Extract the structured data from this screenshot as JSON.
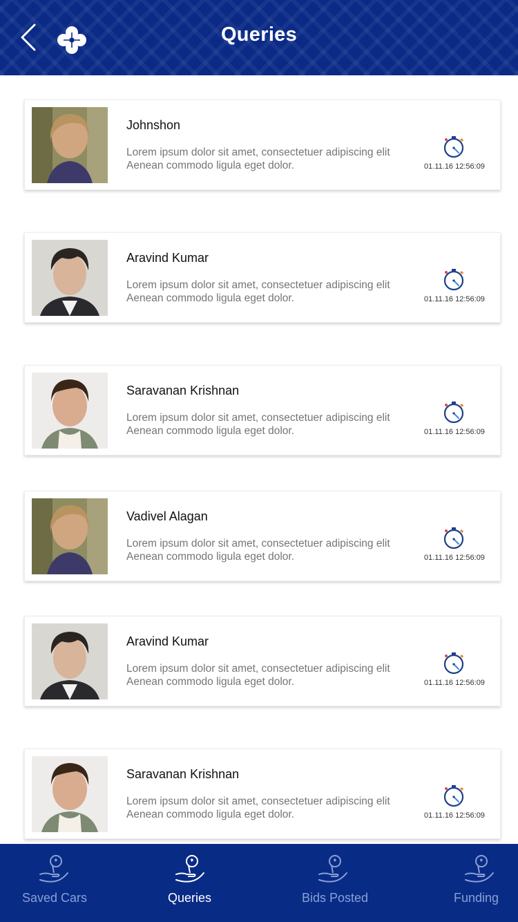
{
  "header": {
    "title": "Queries"
  },
  "queries": [
    {
      "name": "Johnshon",
      "message_line1": "Lorem ipsum dolor sit amet, consectetuer adipiscing elit",
      "message_line2": "Aenean commodo ligula eget dolor.",
      "time": "01.11.16 12:56:09"
    },
    {
      "name": "Aravind Kumar",
      "message_line1": "Lorem ipsum dolor sit amet, consectetuer adipiscing elit",
      "message_line2": "Aenean commodo ligula eget dolor.",
      "time": "01.11.16 12:56:09"
    },
    {
      "name": "Saravanan Krishnan",
      "message_line1": "Lorem ipsum dolor sit amet, consectetuer adipiscing elit",
      "message_line2": "Aenean commodo ligula eget dolor.",
      "time": "01.11.16 12:56:09"
    },
    {
      "name": "Vadivel Alagan",
      "message_line1": "Lorem ipsum dolor sit amet, consectetuer adipiscing elit",
      "message_line2": "Aenean commodo ligula eget dolor.",
      "time": "01.11.16 12:56:09"
    },
    {
      "name": "Aravind Kumar",
      "message_line1": "Lorem ipsum dolor sit amet, consectetuer adipiscing elit",
      "message_line2": "Aenean commodo ligula eget dolor.",
      "time": "01.11.16 12:56:09"
    },
    {
      "name": "Saravanan Krishnan",
      "message_line1": "Lorem ipsum dolor sit amet, consectetuer adipiscing elit",
      "message_line2": "Aenean commodo ligula eget dolor.",
      "time": "01.11.16 12:56:09"
    }
  ],
  "bottom_nav": {
    "items": [
      {
        "label": "Saved Cars",
        "icon": "hand-key-icon",
        "active": false
      },
      {
        "label": "Queries",
        "icon": "hand-key-icon",
        "active": true
      },
      {
        "label": "Bids Posted",
        "icon": "hand-key-icon",
        "active": false
      },
      {
        "label": "Funding",
        "icon": "hand-key-icon",
        "active": false
      }
    ]
  },
  "colors": {
    "header_bg": "#0a2a86",
    "nav_bg": "#082b86",
    "nav_active": "#ffffff",
    "nav_inactive": "#8aa0d4",
    "message_text": "#757575"
  }
}
